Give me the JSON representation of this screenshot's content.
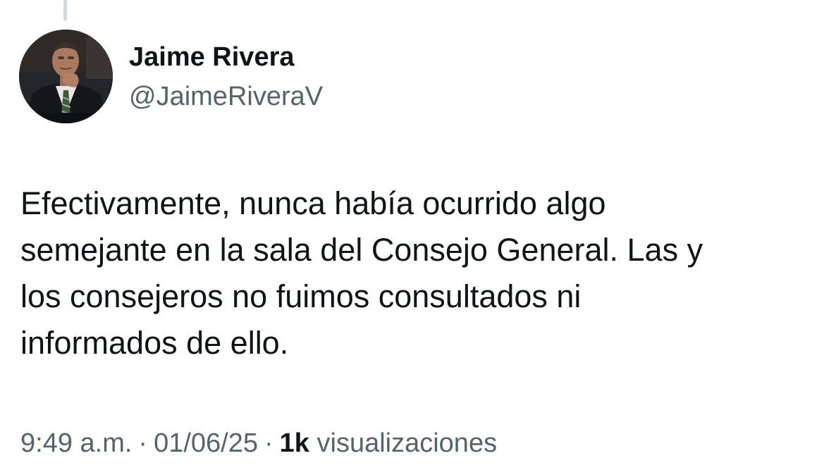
{
  "author": {
    "name": "Jaime Rivera",
    "handle": "@JaimeRiveraV",
    "avatar_icon": "profile-photo"
  },
  "tweet": {
    "text_lines": [
      "Efectivamente, nunca había ocurrido algo",
      "semejante en la sala del Consejo General. Las y",
      "los consejeros no fuimos consultados ni",
      "informados de ello."
    ]
  },
  "meta": {
    "time": "9:49 a.m.",
    "separator": "·",
    "date": "01/06/25",
    "views_count": "1k",
    "views_label": "visualizaciones"
  },
  "colors": {
    "text_primary": "#0f1419",
    "text_secondary": "#536471",
    "thread_line": "#cfd9de",
    "background": "#ffffff"
  }
}
